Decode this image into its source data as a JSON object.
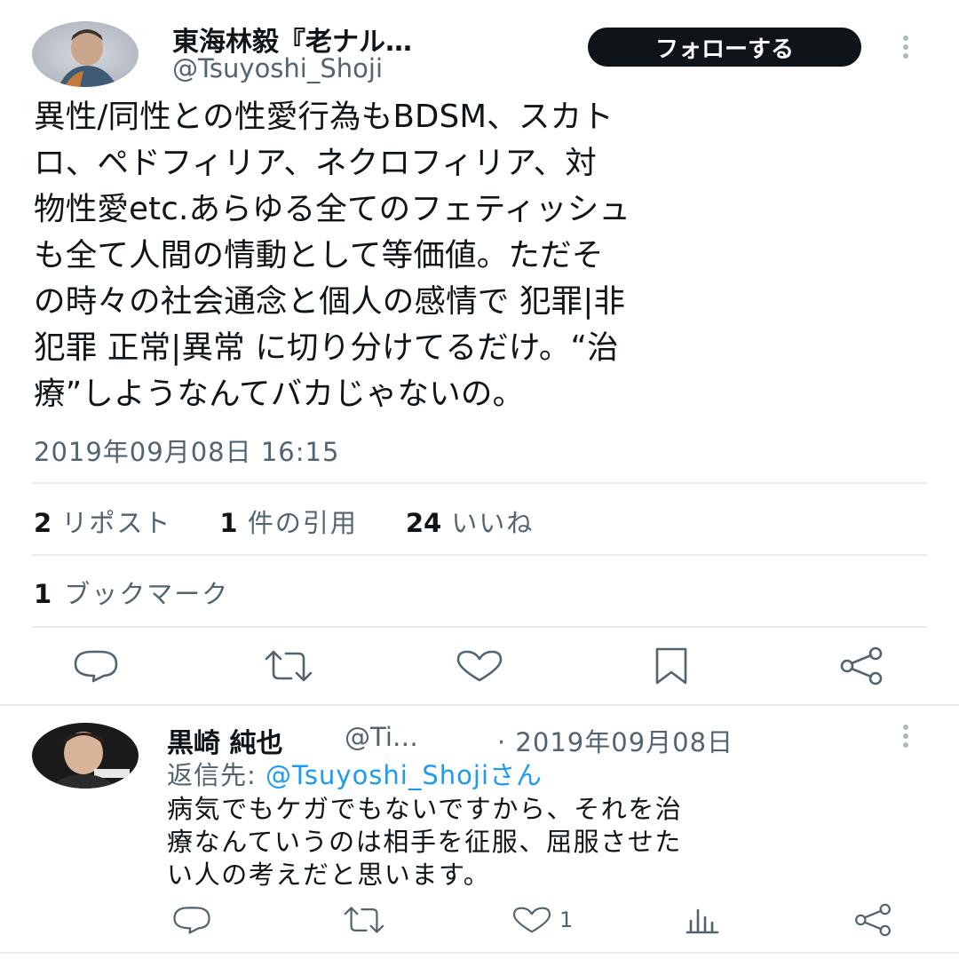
{
  "main_tweet": {
    "author_name": "東海林毅『老ナル…",
    "author_handle": "@Tsuyoshi_Shoji",
    "follow_label": "フォローする",
    "text": "異性/同性との性愛行為もBDSM、スカト\nロ、ペドフィリア、ネクロフィリア、対\n物性愛etc.あらゆる全てのフェティッシュ\nも全て人間の情動として等価値。ただそ\nの時々の社会通念と個人の感情で 犯罪|非\n犯罪 正常|異常 に切り分けてるだけ。“治\n療”しようなんてバカじゃないの。",
    "timestamp": "2019年09月08日 16:15",
    "stats": {
      "reposts_count": "2",
      "reposts_label": "リポスト",
      "quotes_count": "1",
      "quotes_label": "件の引用",
      "likes_count": "24",
      "likes_label": "いいね",
      "bookmarks_count": "1",
      "bookmarks_label": "ブックマーク"
    },
    "actions": [
      "reply-icon",
      "retweet-icon",
      "like-icon",
      "bookmark-icon",
      "share-icon"
    ]
  },
  "reply": {
    "author_name": "黒崎 純也",
    "author_handle": "@Ti…",
    "date": "· 2019年09月08日",
    "reply_to_label": "返信先: ",
    "reply_to_handle": "@Tsuyoshi_Shojiさん",
    "text": "病気でもケガでもないですから、それを治\n療なんていうのは相手を征服、屈服させた\nい人の考えだと思います。",
    "like_count": "1",
    "actions": [
      "reply-icon",
      "retweet-icon",
      "like-icon",
      "views-icon",
      "share-icon"
    ]
  },
  "colors": {
    "text": "#0f1419",
    "secondary": "#536471",
    "link": "#1d9bf0",
    "divider": "#e6ecf0",
    "follow_bg": "#0f1419"
  }
}
